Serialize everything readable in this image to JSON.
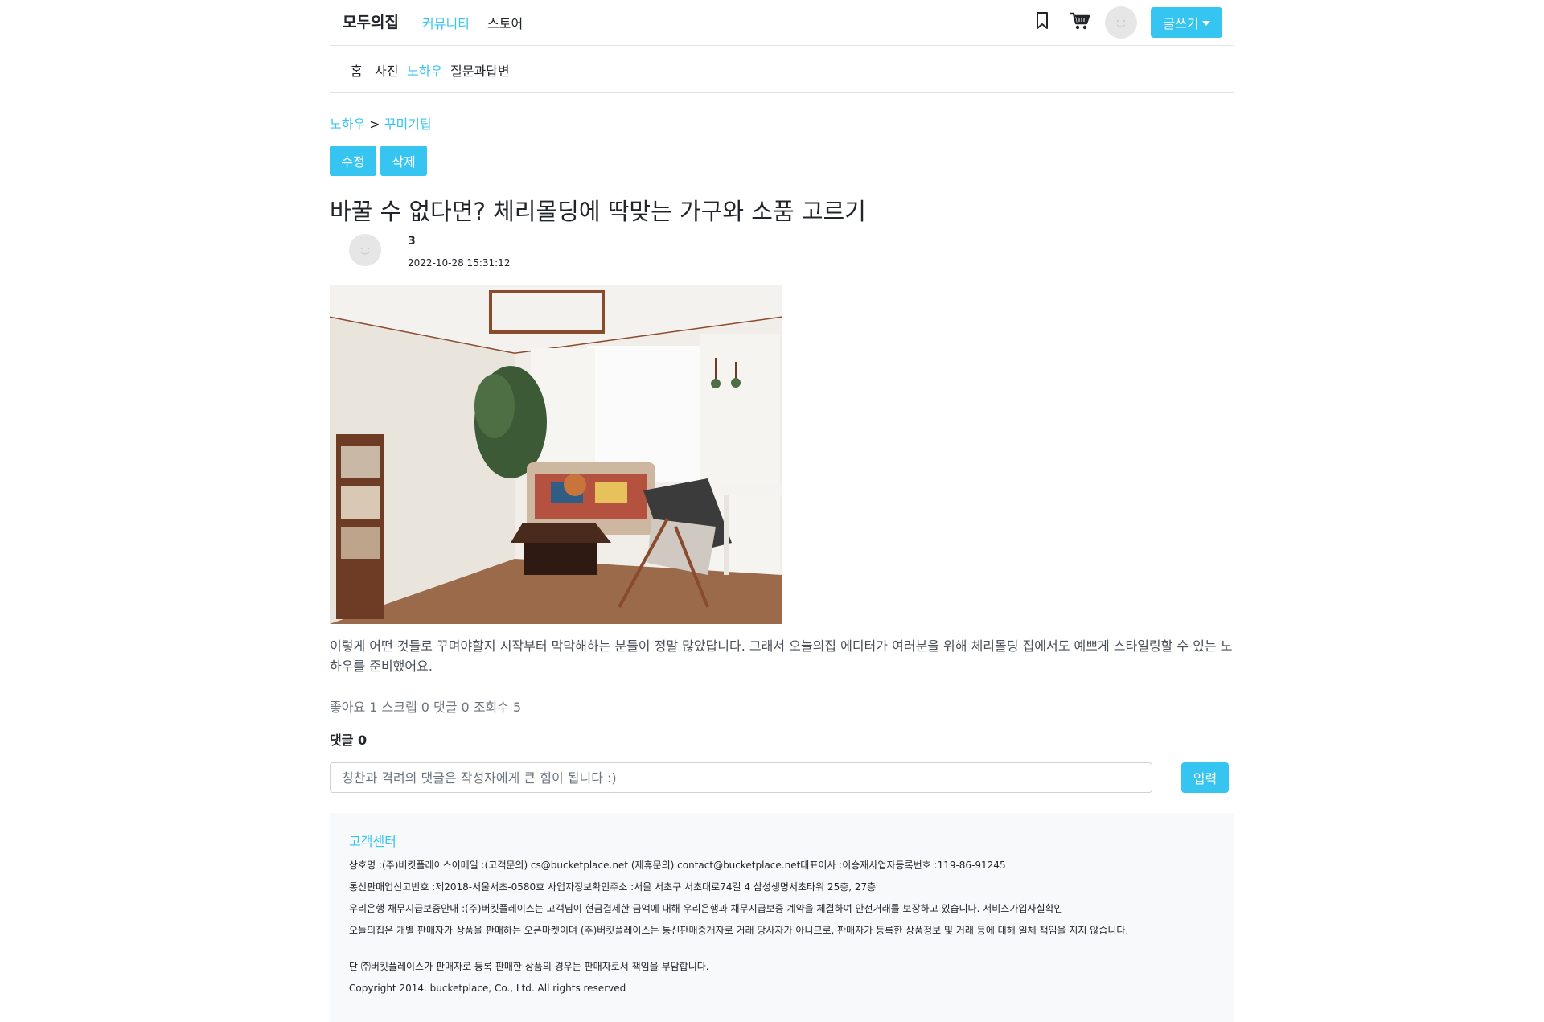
{
  "header": {
    "brand": "모두의집",
    "nav": [
      {
        "label": "커뮤니티",
        "active": true
      },
      {
        "label": "스토어",
        "active": false
      }
    ],
    "icons": [
      "bookmark-icon",
      "cart-icon"
    ],
    "write_label": "글쓰기"
  },
  "subnav": [
    {
      "label": "홈",
      "active": false
    },
    {
      "label": "사진",
      "active": false
    },
    {
      "label": "노하우",
      "active": true
    },
    {
      "label": "질문과답변",
      "active": false
    }
  ],
  "breadcrumb": {
    "root": "노하우",
    "separator": ">",
    "current": "꾸미기팁"
  },
  "actions": {
    "edit": "수정",
    "delete": "삭제"
  },
  "post": {
    "title": "바꿀 수 없다면? 체리몰딩에 딱맞는 가구와 소품 고르기",
    "author": "3",
    "date": "2022-10-28 15:31:12",
    "body": "이렇게 어떤 것들로 꾸며야할지 시작부터 막막해하는 분들이 정말 많았답니다. 그래서 오늘의집 에디터가 여러분을 위해 체리몰딩 집에서도 예쁘게 스타일링할 수 있는 노하우를 준비했어요.",
    "stats": "좋아요 1 스크랩 0 댓글 0 조회수 5"
  },
  "comments": {
    "label": "댓글",
    "count": "0",
    "placeholder": "칭찬과 격려의 댓글은 작성자에게 큰 힘이 됩니다 :)",
    "submit": "입력"
  },
  "footer": {
    "heading": "고객센터",
    "lines": [
      "상호명 :(주)버킷플레이스이메일 :(고객문의) cs@bucketplace.net (제휴문의) contact@bucketplace.net대표이사 :이승재사업자등록번호 :119-86-91245",
      "통신판매업신고번호 :제2018-서울서초-0580호 사업자정보확인주소 :서울 서초구 서초대로74길 4 삼성생명서초타워 25층, 27층",
      "우리은행 채무지급보증안내 :(주)버킷플레이스는 고객님이 현금결제한 금액에 대해 우리은행과 채무지급보증 계약을 체결하여 안전거래를 보장하고 있습니다. 서비스가입사실확인",
      "오늘의집은 개별 판매자가 상품을 판매하는 오픈마켓이며 (주)버킷플레이스는 통신판매중개자로 거래 당사자가 아니므로, 판매자가 등록한 상품정보 및 거래 등에 대해 일체 책임을 지지 않습니다.",
      "단 ㈜버킷플레이스가 판매자로 등록 판매한 상품의 경우는 판매자로서 책임을 부담합니다.",
      "Copyright 2014. bucketplace, Co., Ltd. All rights reserved"
    ]
  },
  "colors": {
    "accent": "#35c5f0",
    "muted": "#6c757d",
    "footer_bg": "#f8f9fa"
  }
}
